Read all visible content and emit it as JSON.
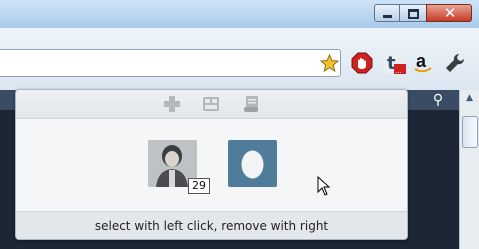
{
  "window": {
    "controls": {
      "minimize_icon": "minimize-icon",
      "maximize_icon": "maximize-icon",
      "close_glyph": "✕"
    }
  },
  "toolbar": {
    "icons": [
      "star-icon",
      "stop-icon",
      "t-extension-icon",
      "amazon-icon",
      "wrench-icon"
    ],
    "t_extension_label": "t",
    "amazon_label": "a"
  },
  "page": {
    "search_glyph": "⚲"
  },
  "popup": {
    "tools": [
      "add-icon",
      "grid-icon",
      "scroll-doc-icon"
    ],
    "accounts": [
      {
        "name": "photo-avatar",
        "count": "29"
      },
      {
        "name": "default-egg-avatar"
      }
    ],
    "footer_text": "select with left click, remove with right"
  },
  "colors": {
    "accent": "#4f7c9b",
    "stop_red": "#cc2222",
    "close_red": "#c43c26",
    "star_yellow": "#f2c230"
  }
}
